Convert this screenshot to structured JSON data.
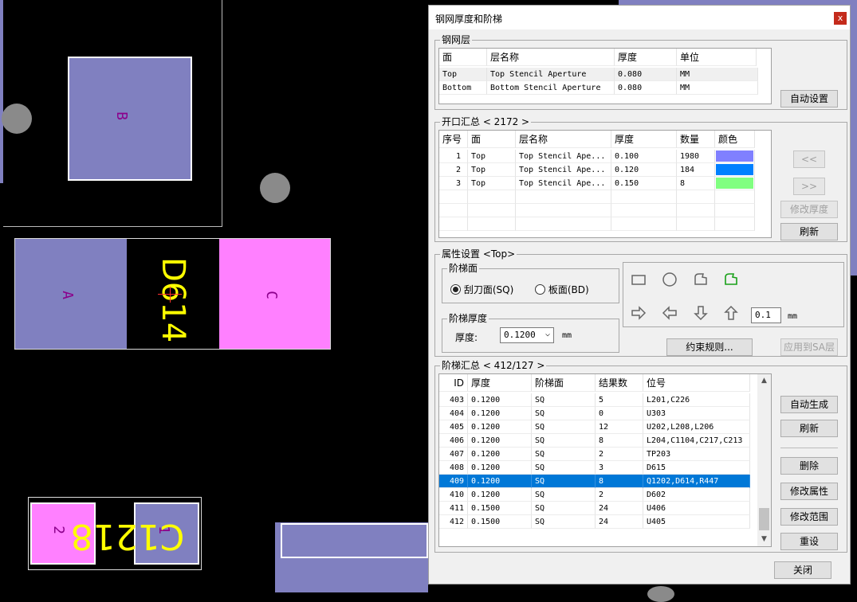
{
  "pcb": {
    "labels": {
      "b": "B",
      "a": "A",
      "c": "C",
      "designator": "D614",
      "c1218": "C1218",
      "num2": "2",
      "num1": "1"
    },
    "colors": {
      "pad_blue": "#8080c0",
      "pad_pink": "#ff80ff",
      "silk_yellow": "#ffff00",
      "hole_gray": "#8a8a8a"
    }
  },
  "dialog": {
    "title": "钢网厚度和阶梯",
    "close_label": "x",
    "stencil_layers": {
      "title": "钢网层",
      "headers": [
        "面",
        "层名称",
        "厚度",
        "单位"
      ],
      "rows": [
        [
          "Top",
          "Top Stencil Aperture",
          "0.080",
          "MM"
        ],
        [
          "Bottom",
          "Bottom Stencil Aperture",
          "0.080",
          "MM"
        ]
      ],
      "auto_set": "自动设置"
    },
    "aperture_summary": {
      "title": "开口汇总 < 2172 >",
      "headers": [
        "序号",
        "面",
        "层名称",
        "厚度",
        "数量",
        "颜色"
      ],
      "rows": [
        {
          "idx": "1",
          "side": "Top",
          "layer": "Top Stencil Ape...",
          "thick": "0.100",
          "count": "1980",
          "color": "#8080ff"
        },
        {
          "idx": "2",
          "side": "Top",
          "layer": "Top Stencil Ape...",
          "thick": "0.120",
          "count": "184",
          "color": "#0080ff"
        },
        {
          "idx": "3",
          "side": "Top",
          "layer": "Top Stencil Ape...",
          "thick": "0.150",
          "count": "8",
          "color": "#80ff80"
        }
      ],
      "prev": "<<",
      "next": ">>",
      "modify_thickness": "修改厚度",
      "refresh": "刷新"
    },
    "property": {
      "title": "属性设置 <Top>",
      "step_face_title": "阶梯面",
      "radio_sq": "刮刀面(SQ)",
      "radio_bd": "板面(BD)",
      "selected": "sq",
      "step_thick_title": "阶梯厚度",
      "thick_label": "厚度:",
      "thick_value": "0.1200",
      "unit": "mm",
      "step_value": "0.1",
      "step_unit": "mm",
      "constraint": "约束规则...",
      "apply_sa": "应用到SA层",
      "icons": [
        "rectangle-icon",
        "circle-icon",
        "polygon-icon",
        "polygon-green-icon",
        "arrow-right-icon",
        "arrow-left-icon",
        "arrow-down-icon",
        "arrow-up-icon"
      ]
    },
    "step_summary": {
      "title": "阶梯汇总 < 412/127 >",
      "headers": [
        "ID",
        "厚度",
        "阶梯面",
        "结果数",
        "位号"
      ],
      "rows": [
        [
          "403",
          "0.1200",
          "SQ",
          "5",
          "L201,C226"
        ],
        [
          "404",
          "0.1200",
          "SQ",
          "0",
          "U303"
        ],
        [
          "405",
          "0.1200",
          "SQ",
          "12",
          "U202,L208,L206"
        ],
        [
          "406",
          "0.1200",
          "SQ",
          "8",
          "L204,C1104,C217,C213"
        ],
        [
          "407",
          "0.1200",
          "SQ",
          "2",
          "TP203"
        ],
        [
          "408",
          "0.1200",
          "SQ",
          "3",
          "D615"
        ],
        [
          "409",
          "0.1200",
          "SQ",
          "8",
          "Q1202,D614,R447"
        ],
        [
          "410",
          "0.1200",
          "SQ",
          "2",
          "D602"
        ],
        [
          "411",
          "0.1500",
          "SQ",
          "24",
          "U406"
        ],
        [
          "412",
          "0.1500",
          "SQ",
          "24",
          "U405"
        ]
      ],
      "selected_row": 6,
      "buttons": {
        "auto_gen": "自动生成",
        "refresh": "刷新",
        "delete": "删除",
        "modify_prop": "修改属性",
        "modify_range": "修改范围",
        "reset": "重设"
      }
    },
    "close": "关闭"
  }
}
